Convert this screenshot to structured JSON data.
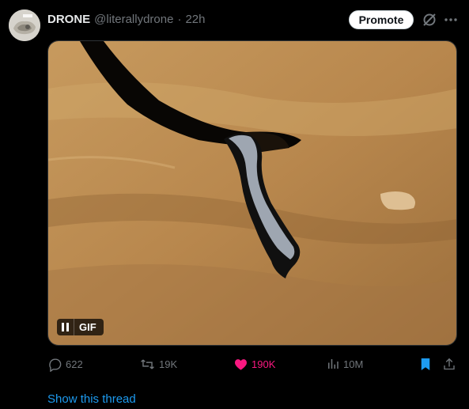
{
  "tweet": {
    "display_name": "DRONE",
    "handle": "@literallydrone",
    "separator": "·",
    "time": "22h",
    "promote_label": "Promote",
    "media": {
      "badge_label": "GIF",
      "state": "playing",
      "pause_icon": "pause-icon"
    },
    "actions": {
      "replies": "622",
      "reposts": "19K",
      "likes": "190K",
      "views": "10M",
      "liked": true,
      "bookmarked": true,
      "like_color": "#f91880",
      "bookmark_color": "#1d9bf0"
    },
    "show_thread_label": "Show this thread"
  },
  "colors": {
    "background": "#000000",
    "text_primary": "#e7e9ea",
    "text_muted": "#71767b",
    "link": "#1d9bf0"
  }
}
